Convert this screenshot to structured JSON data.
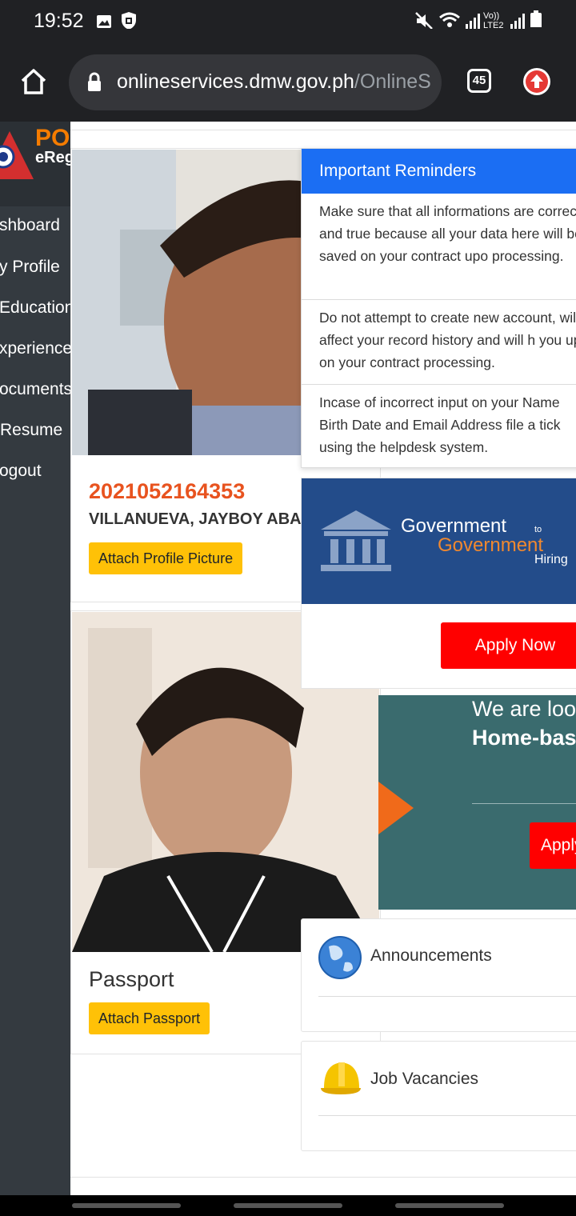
{
  "status_bar": {
    "time": "19:52",
    "network_label": "Vo)) LTE2",
    "icons": [
      "image-icon",
      "shield-icon",
      "mute-icon",
      "wifi-icon",
      "signal-icon",
      "battery-icon"
    ]
  },
  "browser": {
    "url_host": "onlineservices.dmw.gov.ph",
    "url_path": "/OnlineS",
    "tab_count": "45"
  },
  "brand": {
    "logo_text_top": "PO",
    "logo_text_bottom": "eReg"
  },
  "sidebar": {
    "items": [
      {
        "label": "shboard"
      },
      {
        "label": "y Profile"
      },
      {
        "label": "Education"
      },
      {
        "label": "xperience"
      },
      {
        "label": "ocuments"
      },
      {
        "label": "Resume"
      },
      {
        "label": "ogout"
      }
    ]
  },
  "profile": {
    "id_number": "2021052164353",
    "name": "VILLANUEVA, JAYBOY ABAI",
    "attach_profile_label": "Attach Profile Picture"
  },
  "passport": {
    "title": "Passport",
    "attach_label": "Attach Passport"
  },
  "reminders": {
    "title": "Important Reminders",
    "items": [
      "Make sure that all informations are correct and true because all your data here will be saved on your contract upo processing.",
      "Do not attempt to create new account, will affect your record history and will h you up on your contract processing.",
      "Incase of incorrect input on your Name Birth Date and Email Address file a tick using the helpdesk system."
    ]
  },
  "g2g": {
    "line1": "Government",
    "to": "to",
    "line2": "Government",
    "line3": "Hiring",
    "apply_label": "Apply Now"
  },
  "home_based": {
    "line1": "We are look",
    "line2": "Home-base",
    "apply_label": "Apply"
  },
  "announcements": {
    "title": "Announcements"
  },
  "job_vacancies": {
    "title": "Job Vacancies"
  },
  "colors": {
    "accent_blue": "#1b6ef3",
    "id_orange": "#e8531f",
    "button_yellow": "#ffc107",
    "apply_red": "#ff0000",
    "sidebar_dark": "#343a40"
  }
}
